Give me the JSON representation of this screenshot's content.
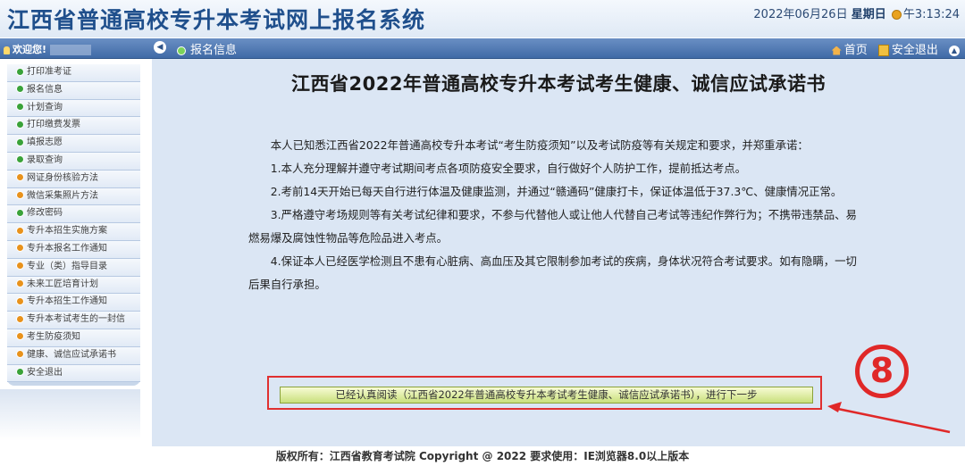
{
  "header": {
    "site_title": "江西省普通高校专升本考试网上报名系统",
    "date": "2022年06月26日",
    "weekday": "星期日",
    "time": "午3:13:24"
  },
  "navbar": {
    "welcome": "欢迎您!",
    "breadcrumb": "报名信息",
    "home_label": "首页",
    "logout_label": "安全退出"
  },
  "sidebar": {
    "items": [
      {
        "label": "打印准考证",
        "dot": "green"
      },
      {
        "label": "报名信息",
        "dot": "green"
      },
      {
        "label": "计划查询",
        "dot": "green"
      },
      {
        "label": "打印缴费发票",
        "dot": "green"
      },
      {
        "label": "填报志愿",
        "dot": "green"
      },
      {
        "label": "录取查询",
        "dot": "green"
      },
      {
        "label": "网证身份核验方法",
        "dot": "orange"
      },
      {
        "label": "微信采集照片方法",
        "dot": "orange"
      },
      {
        "label": "修改密码",
        "dot": "green"
      },
      {
        "label": "专升本招生实施方案",
        "dot": "orange"
      },
      {
        "label": "专升本报名工作通知",
        "dot": "orange"
      },
      {
        "label": "专业（类）指导目录",
        "dot": "orange"
      },
      {
        "label": "未来工匠培育计划",
        "dot": "orange"
      },
      {
        "label": "专升本招生工作通知",
        "dot": "orange"
      },
      {
        "label": "专升本考试考生的一封信",
        "dot": "orange"
      },
      {
        "label": "考生防疫须知",
        "dot": "orange"
      },
      {
        "label": "健康、诚信应试承诺书",
        "dot": "orange"
      },
      {
        "label": "安全退出",
        "dot": "green"
      }
    ]
  },
  "main": {
    "title": "江西省2022年普通高校专升本考试考生健康、诚信应试承诺书",
    "paragraphs": [
      "本人已知悉江西省2022年普通高校专升本考试“考生防疫须知”以及考试防疫等有关规定和要求，并郑重承诺：",
      "1.本人充分理解并遵守考试期间考点各项防疫安全要求，自行做好个人防护工作，提前抵达考点。",
      "2.考前14天开始已每天自行进行体温及健康监测，并通过“赣通码”健康打卡，保证体温低于37.3℃、健康情况正常。",
      "3.严格遵守考场规则等有关考试纪律和要求，不参与代替他人或让他人代替自己考试等违纪作弊行为；不携带违禁品、易燃易爆及腐蚀性物品等危险品进入考点。",
      "4.保证本人已经医学检测且不患有心脏病、高血压及其它限制参加考试的疾病，身体状况符合考试要求。如有隐瞒，一切后果自行承担。"
    ],
    "confirm_button": "已经认真阅读（江西省2022年普通高校专升本考试考生健康、诚信应试承诺书），进行下一步",
    "step_badge": "⑧"
  },
  "footer": {
    "text": "版权所有：江西省教育考试院 Copyright @ 2022 要求使用：IE浏览器8.0以上版本"
  },
  "colors": {
    "header_title": "#1f4f8c",
    "navbar": "#3f6aa6",
    "content_bg": "#dbe6f4",
    "annotation_red": "#e02828",
    "button_green": "#c9e07c"
  }
}
